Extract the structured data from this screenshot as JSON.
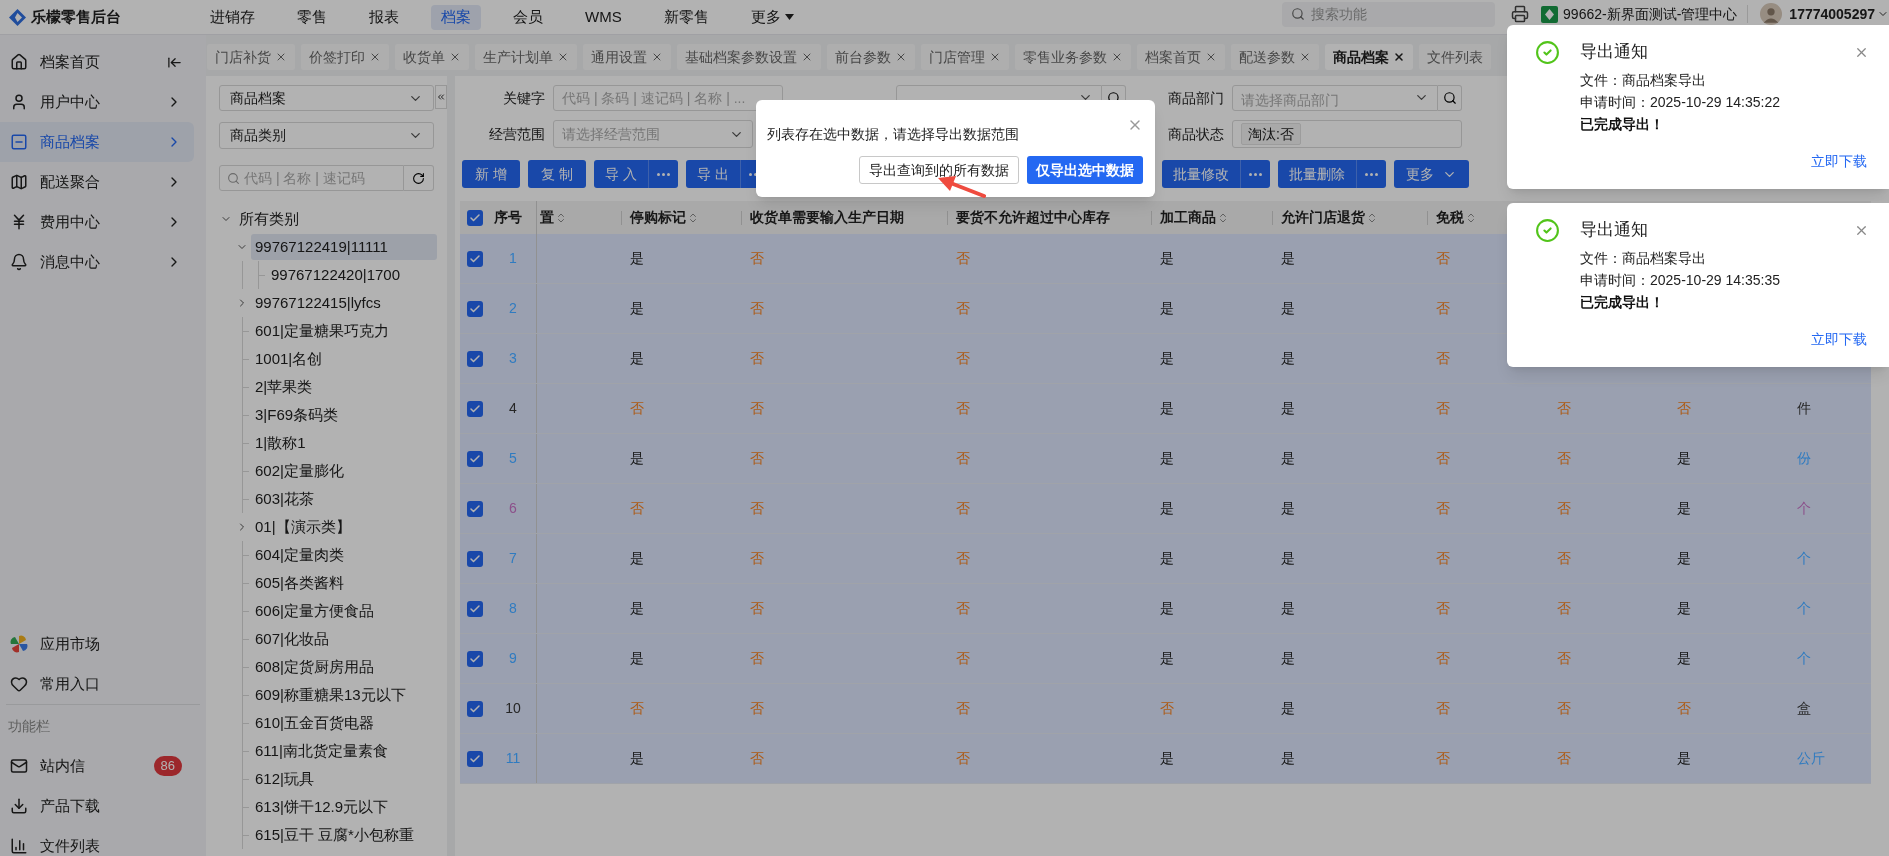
{
  "brand": {
    "name": "乐檬零售后台"
  },
  "top_nav": [
    {
      "label": "进销存",
      "selected": false
    },
    {
      "label": "零售",
      "selected": false
    },
    {
      "label": "报表",
      "selected": false
    },
    {
      "label": "档案",
      "selected": true
    },
    {
      "label": "会员",
      "selected": false
    },
    {
      "label": "WMS",
      "selected": false
    },
    {
      "label": "新零售",
      "selected": false
    },
    {
      "label": "更多",
      "selected": false,
      "kind": "dropdown"
    }
  ],
  "global_search": {
    "placeholder": "搜索功能"
  },
  "store": {
    "name": "99662-新界面测试-管理中心"
  },
  "user": {
    "account": "17774005297"
  },
  "sidebar": {
    "items": [
      {
        "label": "档案首页",
        "kind": "home",
        "selected": false
      },
      {
        "label": "用户中心",
        "kind": "menu",
        "selected": false
      },
      {
        "label": "商品档案",
        "kind": "menu",
        "selected": true
      },
      {
        "label": "配送聚合",
        "kind": "menu",
        "selected": false
      },
      {
        "label": "费用中心",
        "kind": "menu",
        "selected": false
      },
      {
        "label": "消息中心",
        "kind": "menu",
        "selected": false
      }
    ],
    "shortcuts": [
      {
        "label": "应用市场"
      },
      {
        "label": "常用入口"
      }
    ],
    "section_title": "功能栏",
    "function_items": [
      {
        "label": "站内信",
        "badge": "86"
      },
      {
        "label": "产品下载"
      },
      {
        "label": "文件列表"
      }
    ]
  },
  "tabs": [
    {
      "label": "门店补货",
      "selected": false,
      "closable": true
    },
    {
      "label": "价签打印",
      "selected": false,
      "closable": true
    },
    {
      "label": "收货单",
      "selected": false,
      "closable": true
    },
    {
      "label": "生产计划单",
      "selected": false,
      "closable": true
    },
    {
      "label": "通用设置",
      "selected": false,
      "closable": true
    },
    {
      "label": "基础档案参数设置",
      "selected": false,
      "closable": true
    },
    {
      "label": "前台参数",
      "selected": false,
      "closable": true
    },
    {
      "label": "门店管理",
      "selected": false,
      "closable": true
    },
    {
      "label": "零售业务参数",
      "selected": false,
      "closable": true
    },
    {
      "label": "档案首页",
      "selected": false,
      "closable": true
    },
    {
      "label": "配送参数",
      "selected": false,
      "closable": true
    },
    {
      "label": "商品档案",
      "selected": true,
      "closable": true
    },
    {
      "label": "文件列表",
      "selected": false,
      "closable": false
    }
  ],
  "category_panel": {
    "archive_select": "商品档案",
    "type_select": "商品类别",
    "search": {
      "placeholder": "代码 | 名称 | 速记码"
    },
    "tree": [
      {
        "label": "所有类别",
        "expanded": true,
        "selected": false,
        "children": [
          {
            "label": "99767122419|11111",
            "expanded": true,
            "selected": true,
            "children": [
              {
                "label": "99767122420|1700",
                "selected": false
              }
            ]
          },
          {
            "label": "99767122415|lyfcs",
            "expanded": false,
            "selected": false
          },
          {
            "label": "601|定量糖果巧克力",
            "selected": false
          },
          {
            "label": "1001|名创",
            "selected": false
          },
          {
            "label": "2|苹果类",
            "selected": false
          },
          {
            "label": "3|F69条码类",
            "selected": false
          },
          {
            "label": "1|散称1",
            "selected": false
          },
          {
            "label": "602|定量膨化",
            "selected": false
          },
          {
            "label": "603|花茶",
            "selected": false
          },
          {
            "label": "01|【演示类】",
            "expanded": false,
            "selected": false
          },
          {
            "label": "604|定量肉类",
            "selected": false
          },
          {
            "label": "605|各类酱料",
            "selected": false
          },
          {
            "label": "606|定量方便食品",
            "selected": false
          },
          {
            "label": "607|化妆品",
            "selected": false
          },
          {
            "label": "608|定货厨房用品",
            "selected": false
          },
          {
            "label": "609|称重糖果13元以下",
            "selected": false
          },
          {
            "label": "610|五金百货电器",
            "selected": false
          },
          {
            "label": "611|南北货定量素食",
            "selected": false
          },
          {
            "label": "612|玩具",
            "selected": false
          },
          {
            "label": "613|饼干12.9元以下",
            "selected": false
          },
          {
            "label": "615|豆干 豆腐*小包称重",
            "selected": false
          }
        ]
      }
    ]
  },
  "filters": [
    [
      {
        "label": "关键字",
        "kind": "text",
        "placeholder": "代码 | 条码 | 速记码 | 名称 | ..."
      },
      {
        "kind": "select-search"
      },
      {
        "label": "商品部门",
        "kind": "select-search",
        "placeholder": "请选择商品部门"
      }
    ],
    [
      {
        "label": "经营范围",
        "kind": "select",
        "placeholder": "请选择经营范围"
      },
      {
        "label": "商品状态",
        "kind": "tags",
        "tags": [
          "淘汰:否"
        ]
      }
    ]
  ],
  "actions": [
    {
      "label": "新 增",
      "kind": "button"
    },
    {
      "label": "复 制",
      "kind": "button"
    },
    {
      "label": "导 入",
      "kind": "split"
    },
    {
      "label": "导 出",
      "kind": "split"
    }
  ],
  "bulk_actions": [
    {
      "label": "批量修改",
      "kind": "split"
    },
    {
      "label": "批量删除",
      "kind": "split"
    },
    {
      "label": "更多",
      "kind": "dropdown"
    }
  ],
  "table": {
    "all_checked": true,
    "seq_header": {
      "label": "序号"
    },
    "columns": [
      {
        "label": "置",
        "sortable": true
      },
      {
        "label": "停购标记",
        "sortable": true
      },
      {
        "label": "收货单需要输入生产日期",
        "sortable": false
      },
      {
        "label": "要货不允许超过中心库存",
        "sortable": false
      },
      {
        "label": "加工商品",
        "sortable": true
      },
      {
        "label": "允许门店退货",
        "sortable": true
      },
      {
        "label": "免税",
        "sortable": true
      }
    ],
    "rows": [
      {
        "seq": "1",
        "color": "#2f7bc0",
        "selected": true,
        "cells": [
          null,
          {
            "text": "是",
            "yes": true
          },
          {
            "text": "否",
            "yes": false
          },
          {
            "text": "否",
            "yes": false
          },
          {
            "text": "是",
            "yes": true
          },
          {
            "text": "是",
            "yes": true
          },
          {
            "text": "否",
            "yes": false
          },
          null,
          null,
          null
        ]
      },
      {
        "seq": "2",
        "color": "#2f7bc0",
        "selected": true,
        "cells": [
          null,
          {
            "text": "是",
            "yes": true
          },
          {
            "text": "否",
            "yes": false
          },
          {
            "text": "否",
            "yes": false
          },
          {
            "text": "是",
            "yes": true
          },
          {
            "text": "是",
            "yes": true
          },
          {
            "text": "否",
            "yes": false
          },
          null,
          null,
          null
        ]
      },
      {
        "seq": "3",
        "color": "#2f7bc0",
        "selected": true,
        "cells": [
          null,
          {
            "text": "是",
            "yes": true
          },
          {
            "text": "否",
            "yes": false
          },
          {
            "text": "否",
            "yes": false
          },
          {
            "text": "是",
            "yes": true
          },
          {
            "text": "是",
            "yes": true
          },
          {
            "text": "否",
            "yes": false
          },
          null,
          null,
          null
        ]
      },
      {
        "seq": "4",
        "color": "#262626",
        "selected": true,
        "cells": [
          null,
          {
            "text": "否",
            "yes": false
          },
          {
            "text": "否",
            "yes": false
          },
          {
            "text": "否",
            "yes": false
          },
          {
            "text": "是",
            "yes": true
          },
          {
            "text": "是",
            "yes": true
          },
          {
            "text": "否",
            "yes": false
          },
          {
            "text": "否",
            "yes": false
          },
          {
            "text": "否",
            "yes": false
          },
          {
            "text": "件",
            "kind": "unit"
          }
        ]
      },
      {
        "seq": "5",
        "color": "#2f7bc0",
        "selected": true,
        "cells": [
          null,
          {
            "text": "是",
            "yes": true
          },
          {
            "text": "否",
            "yes": false
          },
          {
            "text": "否",
            "yes": false
          },
          {
            "text": "是",
            "yes": true
          },
          {
            "text": "是",
            "yes": true
          },
          {
            "text": "否",
            "yes": false
          },
          {
            "text": "否",
            "yes": false
          },
          {
            "text": "是",
            "yes": true
          },
          {
            "text": "份",
            "kind": "unit"
          }
        ]
      },
      {
        "seq": "6",
        "color": "#8c4f8a",
        "selected": true,
        "cells": [
          null,
          {
            "text": "否",
            "yes": false
          },
          {
            "text": "否",
            "yes": false
          },
          {
            "text": "否",
            "yes": false
          },
          {
            "text": "是",
            "yes": true
          },
          {
            "text": "是",
            "yes": true
          },
          {
            "text": "否",
            "yes": false
          },
          {
            "text": "否",
            "yes": false
          },
          {
            "text": "是",
            "yes": true
          },
          {
            "text": "个",
            "kind": "unit"
          }
        ]
      },
      {
        "seq": "7",
        "color": "#2f7bc0",
        "selected": true,
        "cells": [
          null,
          {
            "text": "是",
            "yes": true
          },
          {
            "text": "否",
            "yes": false
          },
          {
            "text": "否",
            "yes": false
          },
          {
            "text": "是",
            "yes": true
          },
          {
            "text": "是",
            "yes": true
          },
          {
            "text": "否",
            "yes": false
          },
          {
            "text": "否",
            "yes": false
          },
          {
            "text": "是",
            "yes": true
          },
          {
            "text": "个",
            "kind": "unit"
          }
        ]
      },
      {
        "seq": "8",
        "color": "#2f7bc0",
        "selected": true,
        "cells": [
          null,
          {
            "text": "是",
            "yes": true
          },
          {
            "text": "否",
            "yes": false
          },
          {
            "text": "否",
            "yes": false
          },
          {
            "text": "是",
            "yes": true
          },
          {
            "text": "是",
            "yes": true
          },
          {
            "text": "否",
            "yes": false
          },
          {
            "text": "否",
            "yes": false
          },
          {
            "text": "是",
            "yes": true
          },
          {
            "text": "个",
            "kind": "unit"
          }
        ]
      },
      {
        "seq": "9",
        "color": "#2f7bc0",
        "selected": true,
        "cells": [
          null,
          {
            "text": "是",
            "yes": true
          },
          {
            "text": "否",
            "yes": false
          },
          {
            "text": "否",
            "yes": false
          },
          {
            "text": "是",
            "yes": true
          },
          {
            "text": "是",
            "yes": true
          },
          {
            "text": "否",
            "yes": false
          },
          {
            "text": "否",
            "yes": false
          },
          {
            "text": "是",
            "yes": true
          },
          {
            "text": "个",
            "kind": "unit"
          }
        ]
      },
      {
        "seq": "10",
        "color": "#262626",
        "selected": true,
        "cells": [
          null,
          {
            "text": "否",
            "yes": false
          },
          {
            "text": "否",
            "yes": false
          },
          {
            "text": "否",
            "yes": false
          },
          {
            "text": "否",
            "yes": false
          },
          {
            "text": "是",
            "yes": true
          },
          {
            "text": "否",
            "yes": false
          },
          {
            "text": "否",
            "yes": false
          },
          {
            "text": "否",
            "yes": false
          },
          {
            "text": "盒",
            "kind": "unit"
          }
        ]
      },
      {
        "seq": "11",
        "color": "#2f7bc0",
        "selected": true,
        "cells": [
          null,
          {
            "text": "是",
            "yes": true
          },
          {
            "text": "否",
            "yes": false
          },
          {
            "text": "否",
            "yes": false
          },
          {
            "text": "是",
            "yes": true
          },
          {
            "text": "是",
            "yes": true
          },
          {
            "text": "否",
            "yes": false
          },
          {
            "text": "否",
            "yes": false
          },
          {
            "text": "是",
            "yes": true
          },
          {
            "text": "公斤",
            "kind": "unit"
          }
        ]
      }
    ]
  },
  "export_dialog": {
    "message": "列表存在选中数据，请选择导出数据范围",
    "buttons": [
      {
        "label": "导出查询到的所有数据",
        "kind": "default"
      },
      {
        "label": "仅导出选中数据",
        "kind": "primary"
      }
    ]
  },
  "notifications": [
    {
      "title": "导出通知",
      "file": "文件：商品档案导出",
      "time": "申请时间：2025-10-29 14:35:22",
      "status": "已完成导出！",
      "action": "立即下载"
    },
    {
      "title": "导出通知",
      "file": "文件：商品档案导出",
      "time": "申请时间：2025-10-29 14:35:35",
      "status": "已完成导出！",
      "action": "立即下载"
    }
  ]
}
